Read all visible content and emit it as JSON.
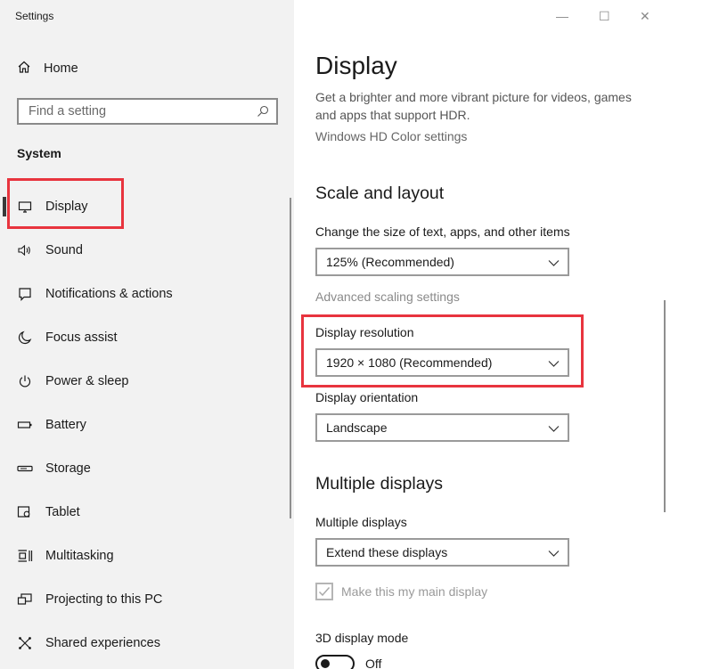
{
  "window": {
    "title": "Settings",
    "minimize": "—",
    "maximize": "☐",
    "close": "✕"
  },
  "sidebar": {
    "home_label": "Home",
    "search_placeholder": "Find a setting",
    "section_label": "System",
    "items": [
      {
        "label": "Display",
        "icon": "monitor-icon",
        "active": true
      },
      {
        "label": "Sound",
        "icon": "speaker-icon"
      },
      {
        "label": "Notifications & actions",
        "icon": "notification-icon"
      },
      {
        "label": "Focus assist",
        "icon": "moon-icon"
      },
      {
        "label": "Power & sleep",
        "icon": "power-icon"
      },
      {
        "label": "Battery",
        "icon": "battery-icon"
      },
      {
        "label": "Storage",
        "icon": "storage-icon"
      },
      {
        "label": "Tablet",
        "icon": "tablet-icon"
      },
      {
        "label": "Multitasking",
        "icon": "multitasking-icon"
      },
      {
        "label": "Projecting to this PC",
        "icon": "projecting-icon"
      },
      {
        "label": "Shared experiences",
        "icon": "shared-icon"
      }
    ]
  },
  "main": {
    "title": "Display",
    "hdr_description": "Get a brighter and more vibrant picture for videos, games and apps that support HDR.",
    "hdr_link": "Windows HD Color settings",
    "scale_heading": "Scale and layout",
    "scale_label": "Change the size of text, apps, and other items",
    "scale_value": "125% (Recommended)",
    "advanced_scaling_link": "Advanced scaling settings",
    "resolution_label": "Display resolution",
    "resolution_value": "1920 × 1080 (Recommended)",
    "orientation_label": "Display orientation",
    "orientation_value": "Landscape",
    "multiple_heading": "Multiple displays",
    "multiple_label": "Multiple displays",
    "multiple_value": "Extend these displays",
    "main_display_label": "Make this my main display",
    "main_display_checked": true,
    "mode_3d_label": "3D display mode",
    "mode_3d_state": "Off"
  },
  "colors": {
    "highlight_box": "#e8343e",
    "sidebar_bg": "#f2f2f2"
  }
}
